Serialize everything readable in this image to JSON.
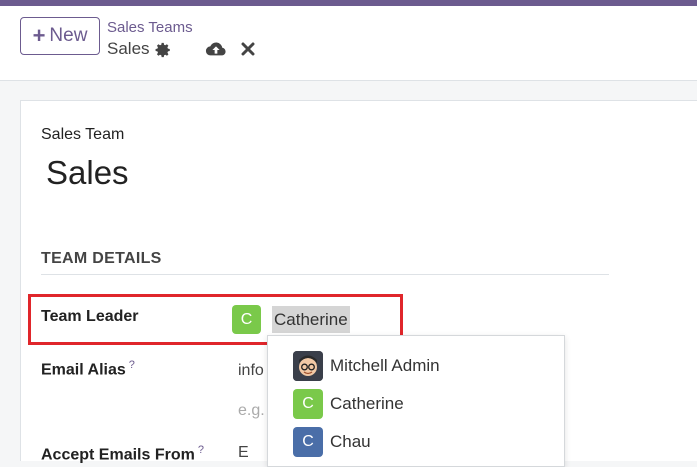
{
  "header": {
    "new_label": "New",
    "breadcrumb_parent": "Sales Teams",
    "breadcrumb_current": "Sales"
  },
  "form": {
    "caption": "Sales Team",
    "name": "Sales",
    "group_title": "TEAM DETAILS",
    "team_leader_label": "Team Leader",
    "team_leader_value": "Catherine",
    "team_leader_initial": "C",
    "email_alias_label": "Email Alias",
    "email_alias_help": "?",
    "email_alias_value": "info",
    "email_alias_placeholder": "e.g.",
    "accept_label": "Accept Emails From",
    "accept_help": "?",
    "accept_value": "E"
  },
  "dropdown": {
    "items": [
      {
        "label": "Mitchell Admin",
        "initial": "",
        "color": "#3a3f4a"
      },
      {
        "label": "Catherine",
        "initial": "C",
        "color": "#7ac94a"
      },
      {
        "label": "Chau",
        "initial": "C",
        "color": "#4a6ea8"
      }
    ]
  },
  "colors": {
    "brand": "#6c5b8f",
    "highlight": "#e0262b"
  }
}
